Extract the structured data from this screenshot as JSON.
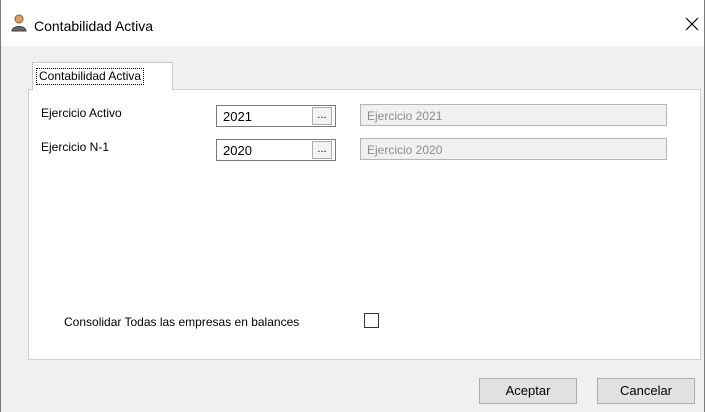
{
  "window": {
    "title": "Contabilidad Activa",
    "icon": "user-icon"
  },
  "tabs": [
    {
      "label": "Contabilidad Activa",
      "selected": true
    }
  ],
  "form": {
    "ejercicio_activo": {
      "label": "Ejercicio Activo",
      "value": "2021",
      "browse_label": "...",
      "description": "Ejercicio 2021"
    },
    "ejercicio_n1": {
      "label": "Ejercicio N-1",
      "value": "2020",
      "browse_label": "...",
      "description": "Ejercicio 2020"
    },
    "consolidar": {
      "label": "Consolidar Todas las empresas en balances",
      "checked": false
    }
  },
  "buttons": {
    "ok_label": "Aceptar",
    "cancel_label": "Cancelar"
  },
  "colors": {
    "window_bg": "#f0f0f0",
    "panel_bg": "#ffffff",
    "disabled_text": "#8d8d8d"
  }
}
